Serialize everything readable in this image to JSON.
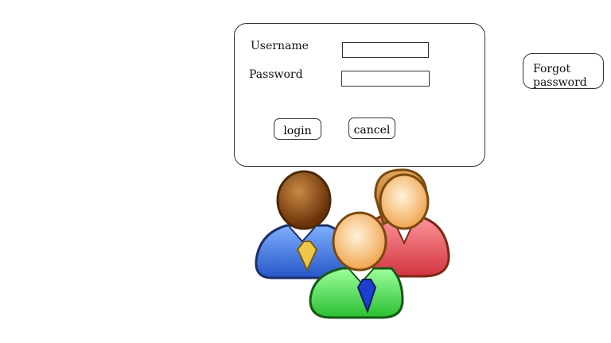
{
  "login_form": {
    "username_label": "Username",
    "username_value": "",
    "password_label": "Password",
    "password_value": "",
    "login_label": "login",
    "cancel_label": "cancel"
  },
  "forgot_password": {
    "label_line1": "Forgot",
    "label_line2": "password"
  },
  "icons": {
    "users": "users-group-icon"
  },
  "colors": {
    "user_blue": "#3b6fd6",
    "user_red": "#e0555f",
    "user_green": "#3fd64a",
    "outline": "#5a4a1a"
  }
}
